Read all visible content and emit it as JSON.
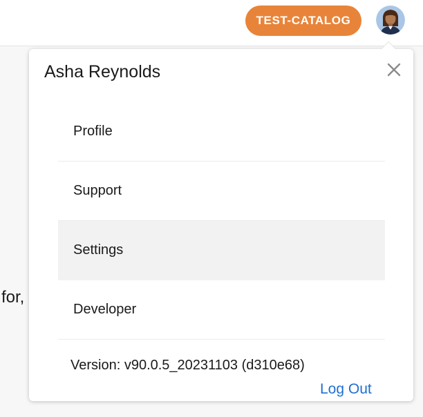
{
  "header": {
    "catalog_badge": "TEST-CATALOG",
    "avatar_icon": "user-avatar-icon"
  },
  "background": {
    "partial_text": "for,"
  },
  "user_menu": {
    "user_name": "Asha Reynolds",
    "close_icon": "close-icon",
    "items": [
      {
        "label": "Profile",
        "active": false
      },
      {
        "label": "Support",
        "active": false
      },
      {
        "label": "Settings",
        "active": true
      },
      {
        "label": "Developer",
        "active": false
      }
    ],
    "version": "Version: v90.0.5_20231103 (d310e68)",
    "logout_label": "Log Out"
  },
  "colors": {
    "accent": "#e88439",
    "link": "#1f6fd1",
    "hover_bg": "#f2f2f2"
  }
}
